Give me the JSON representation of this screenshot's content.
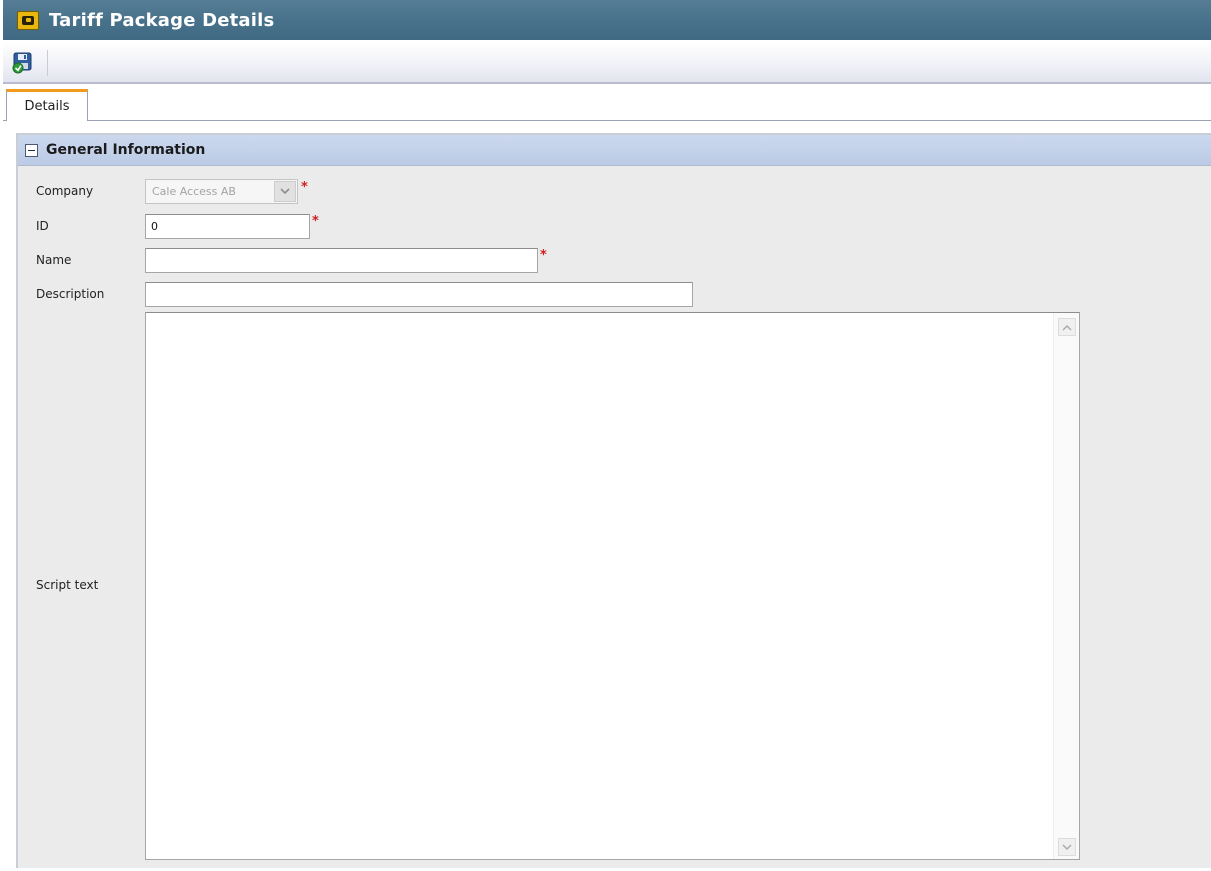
{
  "window": {
    "title": "Tariff Package Details",
    "title_icon": "tariff-package-icon"
  },
  "toolbar": {
    "save_icon": "save-icon"
  },
  "tabs": [
    {
      "label": "Details",
      "active": true
    }
  ],
  "section": {
    "title": "General Information",
    "collapse_icon": "collapse-icon"
  },
  "form": {
    "company": {
      "label": "Company",
      "value": "Cale Access AB",
      "required": true
    },
    "id": {
      "label": "ID",
      "value": "0",
      "required": true
    },
    "name": {
      "label": "Name",
      "value": "",
      "required": true
    },
    "description": {
      "label": "Description",
      "value": ""
    },
    "script_text": {
      "label": "Script text",
      "value": ""
    }
  },
  "required_marker": "*",
  "colors": {
    "title_bar": "#48728b",
    "section_header": "#bccbe6",
    "tab_accent": "#f29a1a",
    "required": "#d21d1d"
  }
}
